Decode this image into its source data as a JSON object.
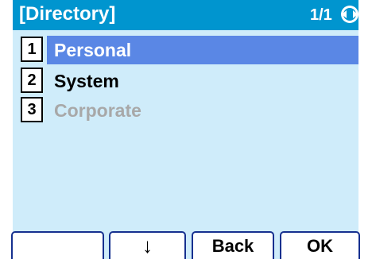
{
  "header": {
    "title": "[Directory]",
    "page_indicator": "1/1",
    "nav_icon": "left-right-nav-icon"
  },
  "menu": {
    "items": [
      {
        "number": "1",
        "label": "Personal",
        "state": "selected"
      },
      {
        "number": "2",
        "label": "System",
        "state": "normal"
      },
      {
        "number": "3",
        "label": "Corporate",
        "state": "disabled"
      }
    ]
  },
  "softkeys": {
    "key1": "",
    "key2": "↓",
    "key3": "Back",
    "key4": "OK"
  },
  "colors": {
    "titlebar": "#0095cf",
    "screen_background": "#cfecfa",
    "selection": "#5a87e5",
    "disabled_text": "#a8a8a8",
    "softkey_border": "#16308f"
  }
}
